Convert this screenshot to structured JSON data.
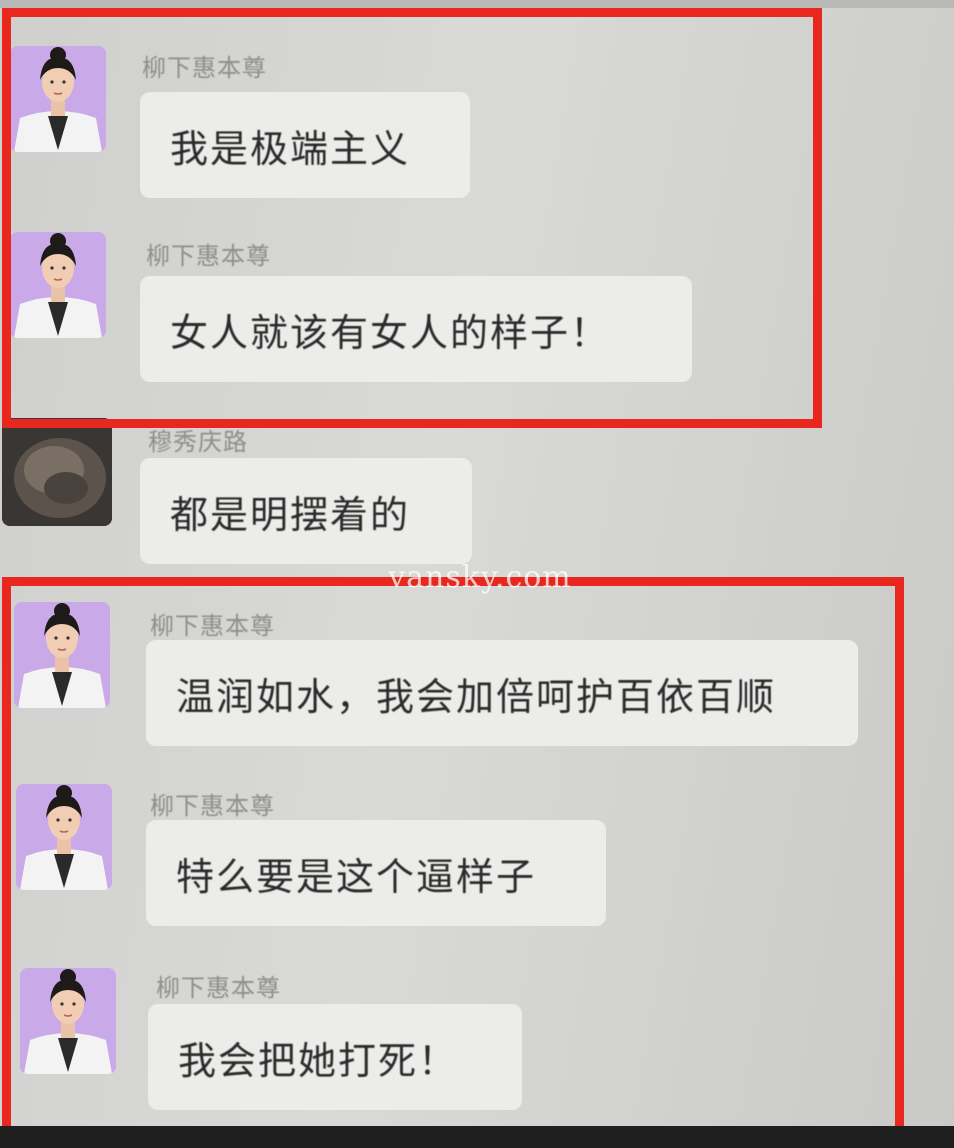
{
  "messages": [
    {
      "sender": "柳下惠本尊",
      "text": "我是极端主义",
      "avatar": "woman-avatar"
    },
    {
      "sender": "柳下惠本尊",
      "text": "女人就该有女人的样子！",
      "avatar": "woman-avatar"
    },
    {
      "sender": "穆秀庆路",
      "text": "都是明摆着的",
      "avatar": "dark-avatar"
    },
    {
      "sender": "柳下惠本尊",
      "text": "温润如水，我会加倍呵护百依百顺",
      "avatar": "woman-avatar"
    },
    {
      "sender": "柳下惠本尊",
      "text": "特么要是这个逼样子",
      "avatar": "woman-avatar"
    },
    {
      "sender": "柳下惠本尊",
      "text": "我会把她打死！",
      "avatar": "woman-avatar"
    }
  ],
  "watermark": "vansky.com",
  "colors": {
    "highlight": "#e8281e",
    "bubble": "#ececea",
    "avatar_bg": "#c9a9e8"
  }
}
